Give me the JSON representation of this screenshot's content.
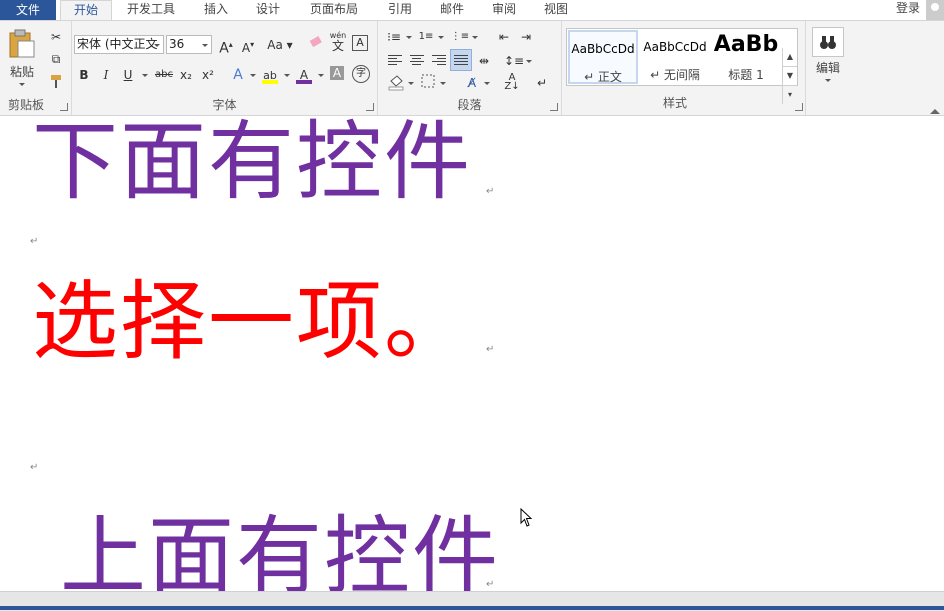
{
  "tabs": {
    "file": "文件",
    "items": [
      "开始",
      "开发工具",
      "插入",
      "设计",
      "页面布局",
      "引用",
      "邮件",
      "审阅",
      "视图"
    ],
    "login": "登录"
  },
  "clipboard": {
    "paste": "粘贴",
    "label": "剪贴板"
  },
  "font": {
    "name": "宋体 (中文正文",
    "size": "36",
    "grow": "A",
    "shrink": "A",
    "case": "Aa",
    "pinyin_top": "wén",
    "pinyin_char": "文",
    "border_char": "A",
    "bold": "B",
    "italic": "I",
    "underline": "U",
    "strike": "abc",
    "subscript": "x₂",
    "superscript": "x²",
    "effects": "A",
    "highlight": "ab",
    "font_color": "A",
    "shading": "A",
    "enclose": "字",
    "label": "字体"
  },
  "paragraph": {
    "label": "段落"
  },
  "styles": {
    "label": "样式",
    "items": [
      {
        "preview": "AaBbCcDd",
        "name": "↵ 正文"
      },
      {
        "preview": "AaBbCcDd",
        "name": "↵ 无间隔"
      },
      {
        "preview": "AaBb",
        "name": "标题 1"
      }
    ]
  },
  "editing": {
    "label": "编辑"
  },
  "document": {
    "line1": "下面有控件",
    "line2": "选择一项。",
    "line3": "上面有控件",
    "para_mark": "↵"
  },
  "colors": {
    "purple": "#7030a0",
    "red": "#ff0000",
    "brand": "#2b579a"
  }
}
